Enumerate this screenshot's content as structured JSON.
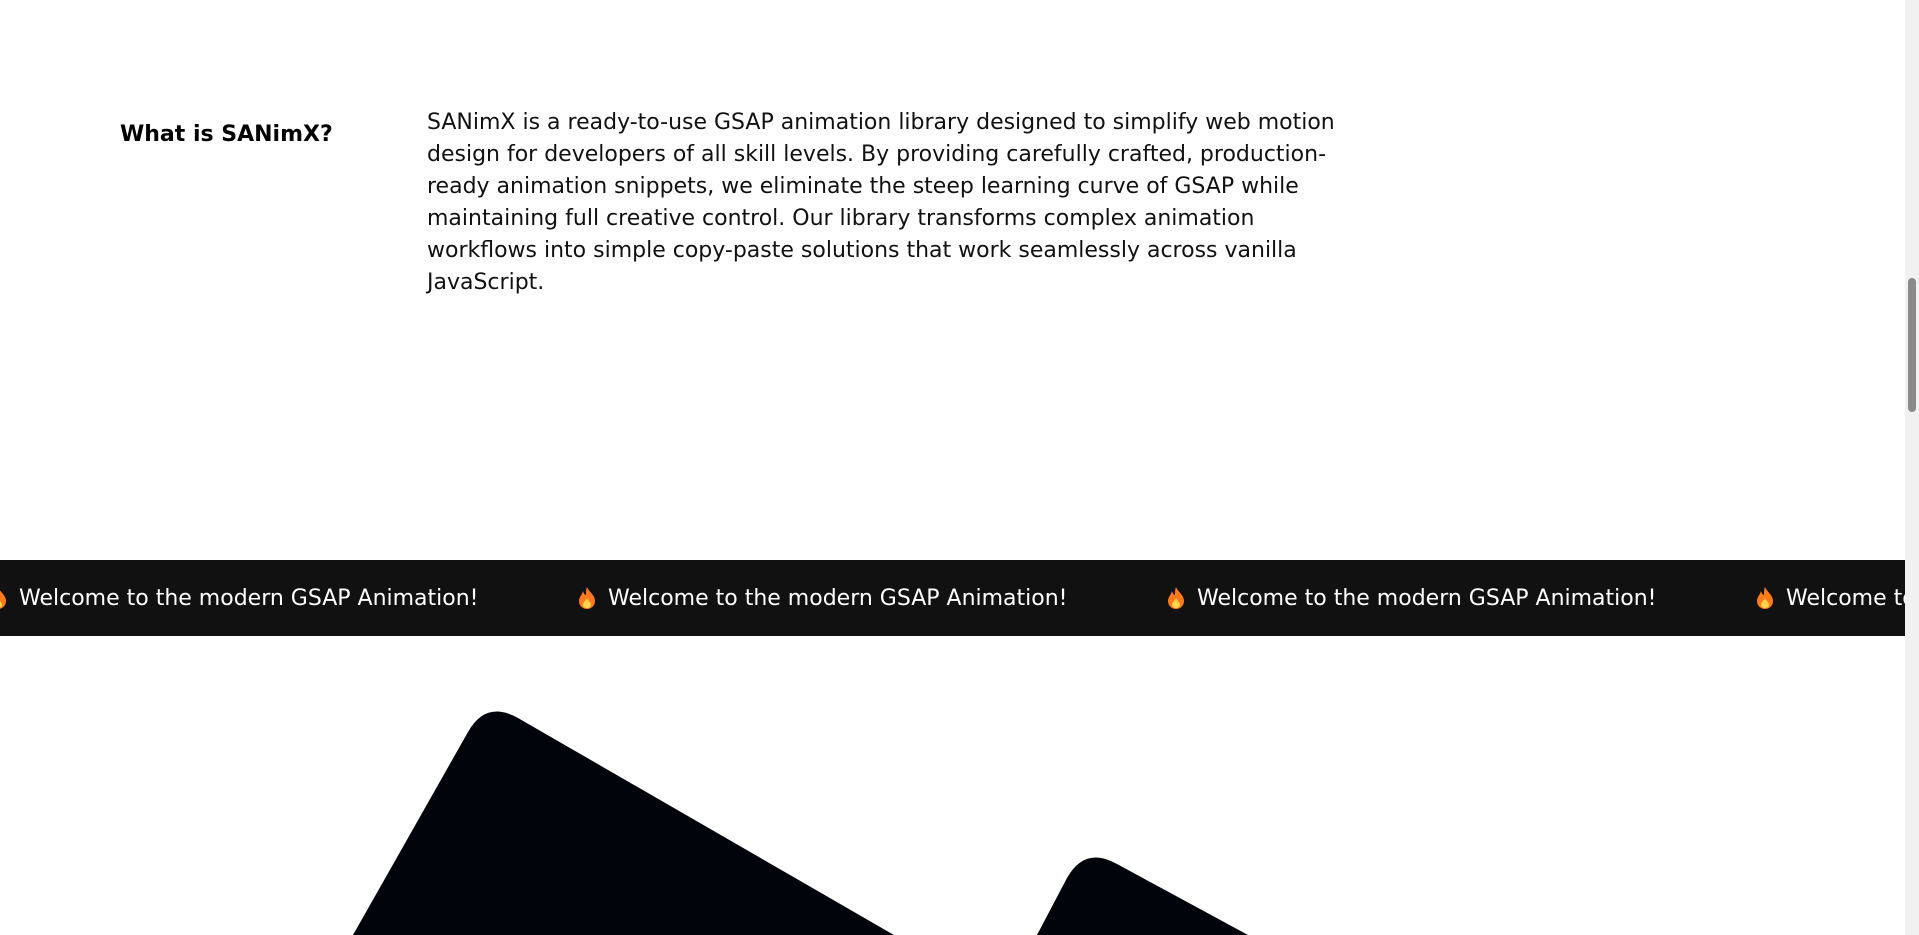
{
  "about": {
    "title": "What is SANimX?",
    "body": "SANimX is a ready-to-use GSAP animation library designed to simplify web motion design for developers of all skill levels. By providing carefully crafted, production-ready animation snippets, we eliminate the steep learning curve of GSAP while maintaining full creative control. Our library transforms complex animation workflows into simple copy-paste solutions that work seamlessly across vanilla JavaScript."
  },
  "marquee": {
    "icon": "flame-icon",
    "items": [
      {
        "text": "Welcome to the modern GSAP Animation!"
      },
      {
        "text": "Welcome to the modern GSAP Animation!"
      },
      {
        "text": "Welcome to the modern GSAP Animation!"
      },
      {
        "text": "Welcome to the modern GSAP Animation!"
      }
    ]
  },
  "colors": {
    "marquee_background": "#111111",
    "marquee_text": "#ffffff",
    "shape_fill": "#02040c",
    "flame_outer": "#ff7a1a",
    "flame_inner": "#ffd34d"
  }
}
